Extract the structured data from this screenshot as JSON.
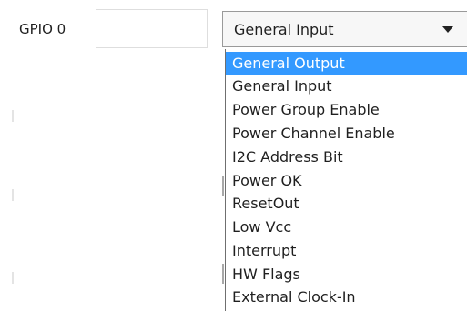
{
  "gpio_row": {
    "label": "GPIO 0",
    "text_value": "",
    "selected_value": "General Input"
  },
  "dropdown": {
    "items": [
      {
        "label": "General Output",
        "highlighted": true
      },
      {
        "label": "General Input",
        "highlighted": false
      },
      {
        "label": "Power Group Enable",
        "highlighted": false
      },
      {
        "label": "Power Channel Enable",
        "highlighted": false
      },
      {
        "label": "I2C Address Bit",
        "highlighted": false
      },
      {
        "label": "Power OK",
        "highlighted": false
      },
      {
        "label": "ResetOut",
        "highlighted": false
      },
      {
        "label": "Low Vcc",
        "highlighted": false
      },
      {
        "label": "Interrupt",
        "highlighted": false
      },
      {
        "label": "HW Flags",
        "highlighted": false
      },
      {
        "label": "External Clock-In",
        "highlighted": false
      }
    ]
  },
  "colors": {
    "highlight": "#3399ff",
    "text": "#1f1f1f",
    "border": "#9a9a9a"
  },
  "icons": {
    "dropdown_arrow": "chevron-down-icon"
  }
}
